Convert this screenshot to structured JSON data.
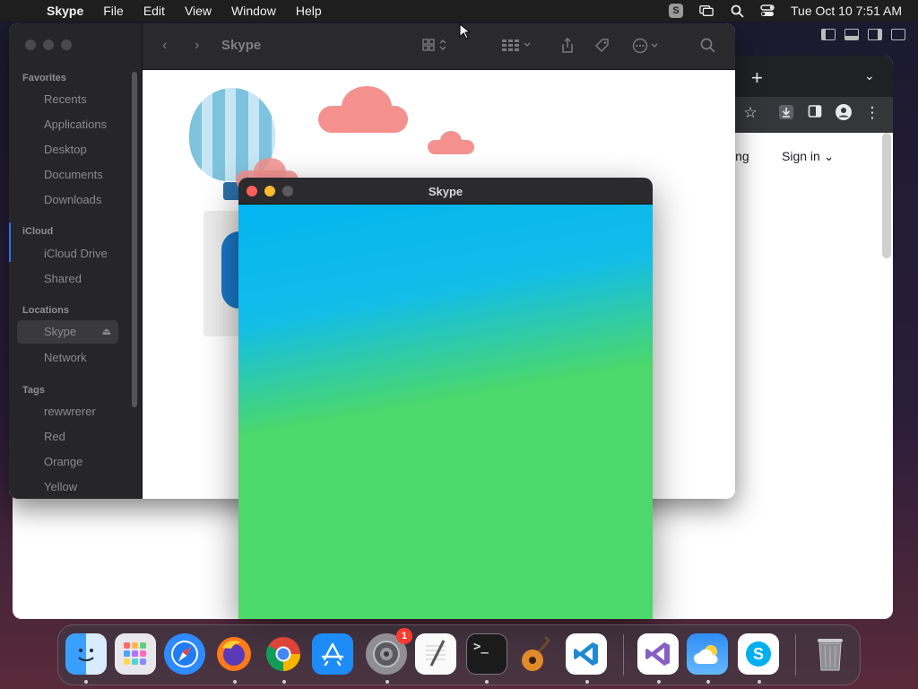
{
  "menubar": {
    "app_name": "Skype",
    "items": [
      "File",
      "Edit",
      "View",
      "Window",
      "Help"
    ],
    "datetime": "Tue Oct 10  7:51 AM",
    "status_icons": [
      "skype-status-icon",
      "screen-mirroring-icon",
      "search-icon",
      "control-center-icon"
    ]
  },
  "chrome": {
    "new_tab_label": "+",
    "partial_link": "ing",
    "sign_in_label": "Sign in ⌄"
  },
  "finder": {
    "title": "Skype",
    "sidebar": {
      "favorites_heading": "Favorites",
      "favorites": [
        "Recents",
        "Applications",
        "Desktop",
        "Documents",
        "Downloads"
      ],
      "icloud_heading": "iCloud",
      "icloud": [
        "iCloud Drive",
        "Shared"
      ],
      "locations_heading": "Locations",
      "locations": [
        "Skype",
        "Network"
      ],
      "tags_heading": "Tags",
      "tags": [
        "rewwrerer",
        "Red",
        "Orange",
        "Yellow"
      ],
      "selected": "Skype"
    }
  },
  "skype_window": {
    "title": "Skype",
    "traffic_colors": [
      "#ff5f57",
      "#febc2e",
      "#5a5a5c"
    ]
  },
  "dock": {
    "apps": [
      "Finder",
      "Launchpad",
      "Safari",
      "Firefox",
      "Chrome",
      "App Store",
      "System Settings",
      "TextEdit",
      "Terminal",
      "GarageBand",
      "Visual Studio Code",
      "Visual Studio",
      "Weather",
      "Skype",
      "Trash"
    ],
    "system_settings_badge": "1"
  }
}
